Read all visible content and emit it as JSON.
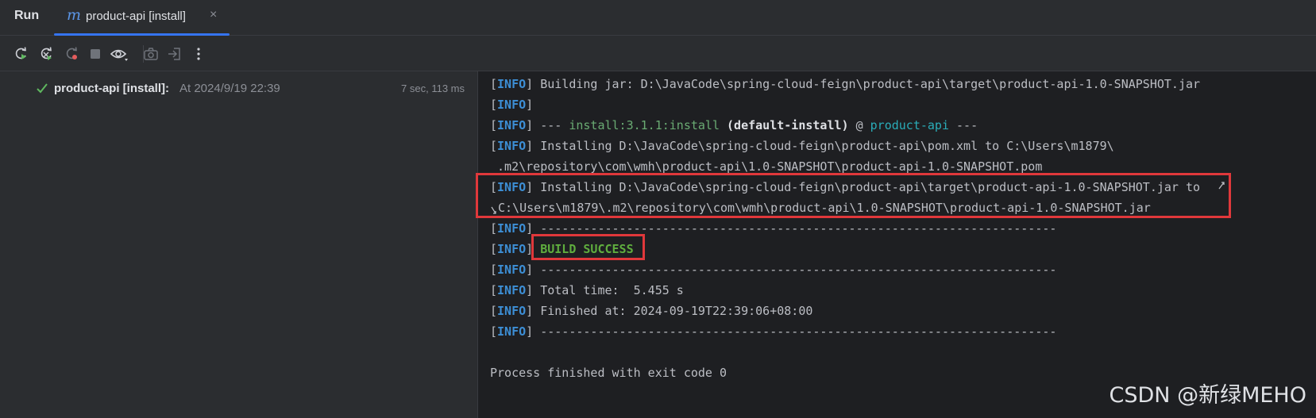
{
  "tabbar": {
    "run_label": "Run",
    "tab": {
      "icon": "maven-m-icon",
      "icon_glyph": "m",
      "label": "product-api [install]",
      "close_glyph": "×"
    }
  },
  "toolbar": {
    "buttons": [
      "rerun-icon",
      "rerun-failed-icon",
      "rerun-disabled-icon",
      "stop-icon",
      "view-icon",
      "screenshot-icon",
      "export-icon",
      "more-icon"
    ]
  },
  "tree": {
    "status_icon": "checkmark-icon",
    "name": "product-api [install]:",
    "when": "At 2024/9/19 22:39",
    "duration": "7 sec, 113 ms"
  },
  "console": {
    "info_tag": "INFO",
    "lines": {
      "l1": " Building jar: D:\\JavaCode\\spring-cloud-feign\\product-api\\target\\product-api-1.0-SNAPSHOT.jar",
      "l3_a": " --- ",
      "l3_plugin": "install:3.1.1:install",
      "l3_exec": " (default-install)",
      "l3_at": " @ ",
      "l3_project": "product-api",
      "l3_end": " ---",
      "l4": " Installing D:\\JavaCode\\spring-cloud-feign\\product-api\\pom.xml to C:\\Users\\m1879\\",
      "l5": " .m2\\repository\\com\\wmh\\product-api\\1.0-SNAPSHOT\\product-api-1.0-SNAPSHOT.pom",
      "l6": " Installing D:\\JavaCode\\spring-cloud-feign\\product-api\\target\\product-api-1.0-SNAPSHOT.jar to ",
      "l7": "C:\\Users\\m1879\\.m2\\repository\\com\\wmh\\product-api\\1.0-SNAPSHOT\\product-api-1.0-SNAPSHOT.jar",
      "dashes": " ------------------------------------------------------------------------",
      "build_success": "BUILD SUCCESS",
      "total_time": " Total time:  5.455 s",
      "finished_at": " Finished at: 2024-09-19T22:39:06+08:00",
      "exit": "Process finished with exit code 0"
    }
  },
  "watermark": "CSDN @新绿MEHO",
  "colors": {
    "accent": "#3574f0",
    "info": "#3d8fd6",
    "success": "#5fad3e",
    "highlight": "#e0383b"
  }
}
